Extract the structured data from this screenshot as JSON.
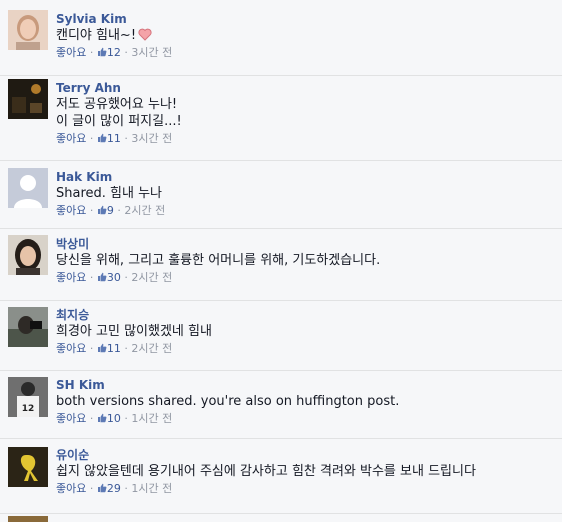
{
  "comments": [
    {
      "name": "Sylvia Kim",
      "text": "캔디야 힘내~!",
      "heart": true,
      "like_label": "좋아요",
      "count": "12",
      "time": "3시간 전"
    },
    {
      "name": "Terry Ahn",
      "text": "저도 공유했어요 누나!\n이 글이 많이 퍼지길...!",
      "heart": false,
      "like_label": "좋아요",
      "count": "11",
      "time": "3시간 전"
    },
    {
      "name": "Hak Kim",
      "text": "Shared. 힘내 누나",
      "heart": false,
      "like_label": "좋아요",
      "count": "9",
      "time": "2시간 전"
    },
    {
      "name": "박상미",
      "text": "당신을 위해, 그리고 훌륭한 어머니를 위해, 기도하겠습니다.",
      "heart": false,
      "like_label": "좋아요",
      "count": "30",
      "time": "2시간 전"
    },
    {
      "name": "최지승",
      "text": "희경아 고민 많이했겠네 힘내",
      "heart": false,
      "like_label": "좋아요",
      "count": "11",
      "time": "2시간 전"
    },
    {
      "name": "SH Kim",
      "text": "both versions shared. you're also on huffington post.",
      "heart": false,
      "like_label": "좋아요",
      "count": "10",
      "time": "1시간 전"
    },
    {
      "name": "유이순",
      "text": "쉽지 않았을텐데 용기내어 주심에 감사하고 힘찬 격려와 박수를 보내 드립니다",
      "heart": false,
      "like_label": "좋아요",
      "count": "29",
      "time": "1시간 전"
    }
  ],
  "icons": {
    "like": "thumbs-up-icon",
    "heart": "heart-icon"
  },
  "colors": {
    "link": "#3b5998",
    "meta": "#9197a3",
    "background": "#f6f7f9",
    "divider": "#e1e2e3"
  }
}
